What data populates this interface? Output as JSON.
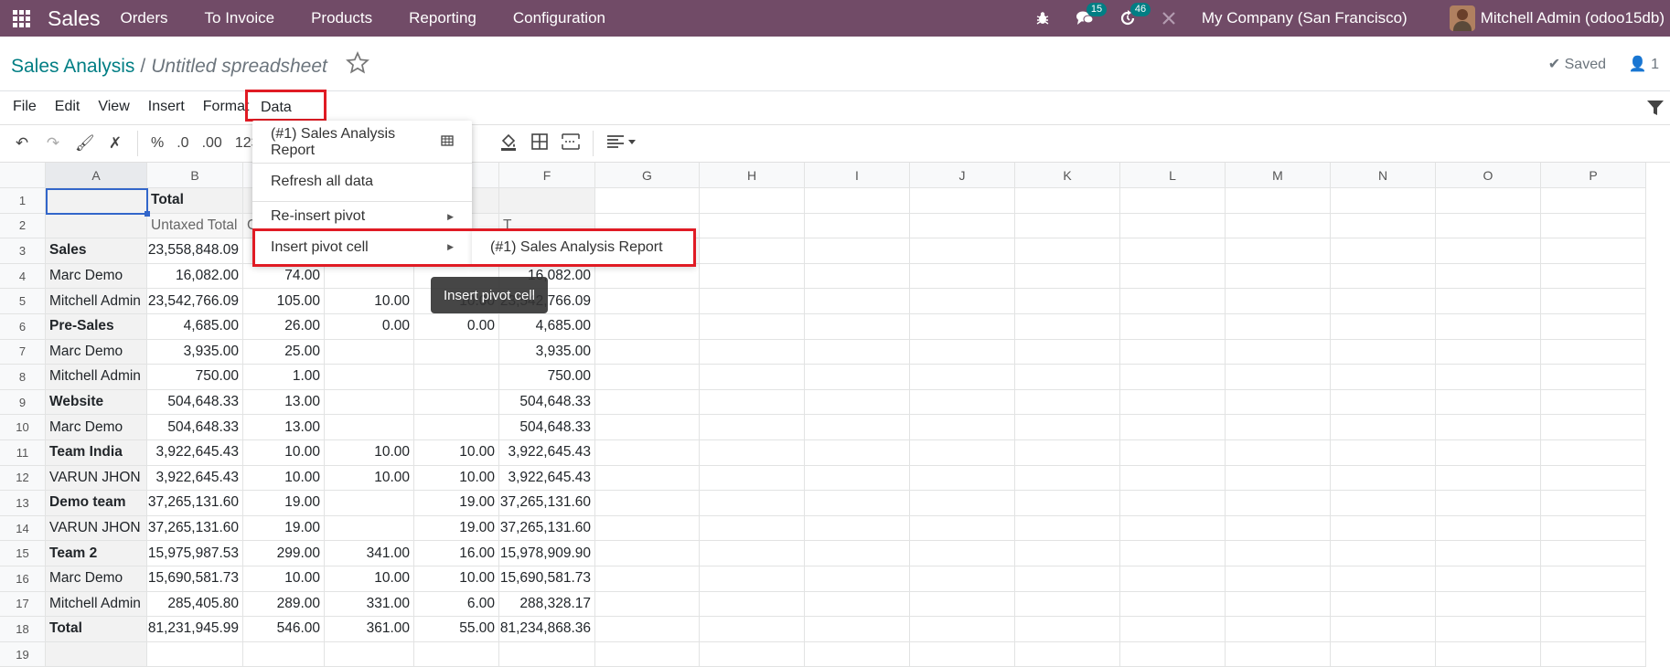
{
  "navbar": {
    "brand": "Sales",
    "menu": [
      "Orders",
      "To Invoice",
      "Products",
      "Reporting",
      "Configuration"
    ],
    "messages_badge": "15",
    "activities_badge": "46",
    "company": "My Company (San Francisco)",
    "user": "Mitchell Admin (odoo15db)",
    "bg_color": "#714B67"
  },
  "control": {
    "breadcrumb_root": "Sales Analysis",
    "breadcrumb_sep": "/",
    "title": "Untitled spreadsheet",
    "saved": "Saved",
    "users_count": "1"
  },
  "menubar": [
    "File",
    "Edit",
    "View",
    "Insert",
    "Format",
    "Data"
  ],
  "toolbar": {
    "pct": "%",
    "dec0": ".0",
    "dec00": ".00",
    "fmt": "123"
  },
  "columns": [
    "A",
    "B",
    "C",
    "D",
    "E",
    "F",
    "G",
    "H",
    "I",
    "J",
    "K",
    "L",
    "M",
    "N",
    "O",
    "P"
  ],
  "rows": [
    [
      "",
      "Total",
      "",
      "",
      "",
      ""
    ],
    [
      "",
      "Untaxed Total",
      "G",
      "",
      "",
      "T"
    ],
    [
      "Sales",
      "23,558,848.09",
      "",
      "",
      "",
      ""
    ],
    [
      "Marc Demo",
      "16,082.00",
      "74.00",
      "",
      "",
      "16,082.00"
    ],
    [
      "Mitchell Admin",
      "23,542,766.09",
      "105.00",
      "10.00",
      "10.00",
      "23,542,766.09"
    ],
    [
      "Pre-Sales",
      "4,685.00",
      "26.00",
      "0.00",
      "0.00",
      "4,685.00"
    ],
    [
      "Marc Demo",
      "3,935.00",
      "25.00",
      "",
      "",
      "3,935.00"
    ],
    [
      "Mitchell Admin",
      "750.00",
      "1.00",
      "",
      "",
      "750.00"
    ],
    [
      "Website",
      "504,648.33",
      "13.00",
      "",
      "",
      "504,648.33"
    ],
    [
      "Marc Demo",
      "504,648.33",
      "13.00",
      "",
      "",
      "504,648.33"
    ],
    [
      "Team India",
      "3,922,645.43",
      "10.00",
      "10.00",
      "10.00",
      "3,922,645.43"
    ],
    [
      "VARUN JHON",
      "3,922,645.43",
      "10.00",
      "10.00",
      "10.00",
      "3,922,645.43"
    ],
    [
      "Demo team",
      "37,265,131.60",
      "19.00",
      "",
      "19.00",
      "37,265,131.60"
    ],
    [
      "VARUN JHON",
      "37,265,131.60",
      "19.00",
      "",
      "19.00",
      "37,265,131.60"
    ],
    [
      "Team 2",
      "15,975,987.53",
      "299.00",
      "341.00",
      "16.00",
      "15,978,909.90"
    ],
    [
      "Marc Demo",
      "15,690,581.73",
      "10.00",
      "10.00",
      "10.00",
      "15,690,581.73"
    ],
    [
      "Mitchell Admin",
      "285,405.80",
      "289.00",
      "331.00",
      "6.00",
      "288,328.17"
    ],
    [
      "Total",
      "81,231,945.99",
      "546.00",
      "361.00",
      "55.00",
      "81,234,868.36"
    ],
    [
      "",
      "",
      "",
      "",
      "",
      ""
    ]
  ],
  "bold_rows": [
    1,
    3,
    6,
    9,
    11,
    13,
    15,
    18
  ],
  "data_menu": {
    "item1": "(#1) Sales Analysis Report",
    "item2": "Refresh all data",
    "item3": "Re-insert pivot",
    "item4": "Insert pivot cell",
    "submenu": "(#1) Sales Analysis Report",
    "tooltip": "Insert pivot cell"
  }
}
